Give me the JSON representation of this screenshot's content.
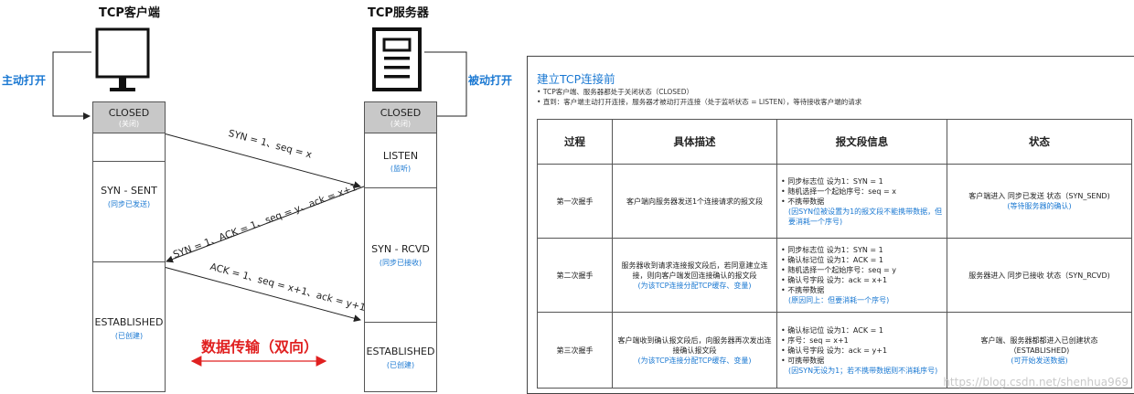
{
  "client": {
    "title": "TCP客户端",
    "open_label": "主动打开",
    "icon": "monitor-icon",
    "states": [
      {
        "main": "CLOSED",
        "sub": "(关闭)"
      },
      {
        "main": "SYN - SENT",
        "sub": "(同步已发送)"
      },
      {
        "main": "ESTABLISHED",
        "sub": "(已创建)"
      }
    ]
  },
  "server": {
    "title": "TCP服务器",
    "open_label": "被动打开",
    "icon": "server-document-icon",
    "states": [
      {
        "main": "CLOSED",
        "sub": "(关闭)"
      },
      {
        "main": "LISTEN",
        "sub": "(监听)"
      },
      {
        "main": "SYN - RCVD",
        "sub": "(同步已接收)"
      },
      {
        "main": "ESTABLISHED",
        "sub": "(已创建)"
      }
    ]
  },
  "messages": [
    "SYN = 1、seq = x",
    "SYN = 1、ACK = 1、seq = y、ack = x+1",
    "ACK = 1、seq = x+1、ack = y+1"
  ],
  "data_transfer": {
    "label": "数据传输（双向）",
    "color": "#e02020"
  },
  "panel": {
    "title": "建立TCP连接前",
    "notes": [
      "TCP客户端、服务器都处于关闭状态（CLOSED）",
      "直到：客户端主动打开连接，服务器才被动打开连接（处于监听状态 = LISTEN），等待接收客户端的请求"
    ],
    "columns": [
      "过程",
      "具体描述",
      "报文段信息",
      "状态"
    ],
    "rows": [
      {
        "step": "第一次握手",
        "desc": [
          "客户端向服务器发送1个连接请求的报文段"
        ],
        "desc_note": "",
        "info": [
          "同步标志位 设为1：SYN = 1",
          "随机选择一个起始序号：seq = x",
          "不携带数据"
        ],
        "info_note": "(因SYN位被设置为1的报文段不能携带数据，但要消耗一个序号)",
        "state": "客户端进入 同步已发送 状态（SYN_SEND)",
        "state_note": "(等待服务器的确认)"
      },
      {
        "step": "第二次握手",
        "desc": [
          "服务器收到请求连接报文段后，若同意建立连接，则向客户端发回连接确认的报文段"
        ],
        "desc_note": "(为该TCP连接分配TCP缓存、变量)",
        "info": [
          "同步标志位 设为1：SYN = 1",
          "确认标记位 设为1：ACK = 1",
          "随机选择一个起始序号：seq = y",
          "确认号字段 设为：ack = x+1",
          "不携带数据"
        ],
        "info_note": "(原因同上：但要消耗一个序号)",
        "state": "服务器进入 同步已接收 状态（SYN_RCVD)",
        "state_note": ""
      },
      {
        "step": "第三次握手",
        "desc": [
          "客户端收到确认报文段后，向服务器再次发出连接确认报文段"
        ],
        "desc_note": "(为该TCP连接分配TCP缓存、变量)",
        "info": [
          "确认标记位 设为1：ACK = 1",
          "序号：seq = x+1",
          "确认号字段 设为：ack = y+1",
          "可携带数据"
        ],
        "info_note": "(因SYN无设为1；若不携带数据则不消耗序号)",
        "state": "客户端、服务器都都进入已创建状态（ESTABLISHED)",
        "state_note": "(可开始发送数据)"
      }
    ]
  },
  "watermark": "https://blog.csdn.net/shenhua969"
}
